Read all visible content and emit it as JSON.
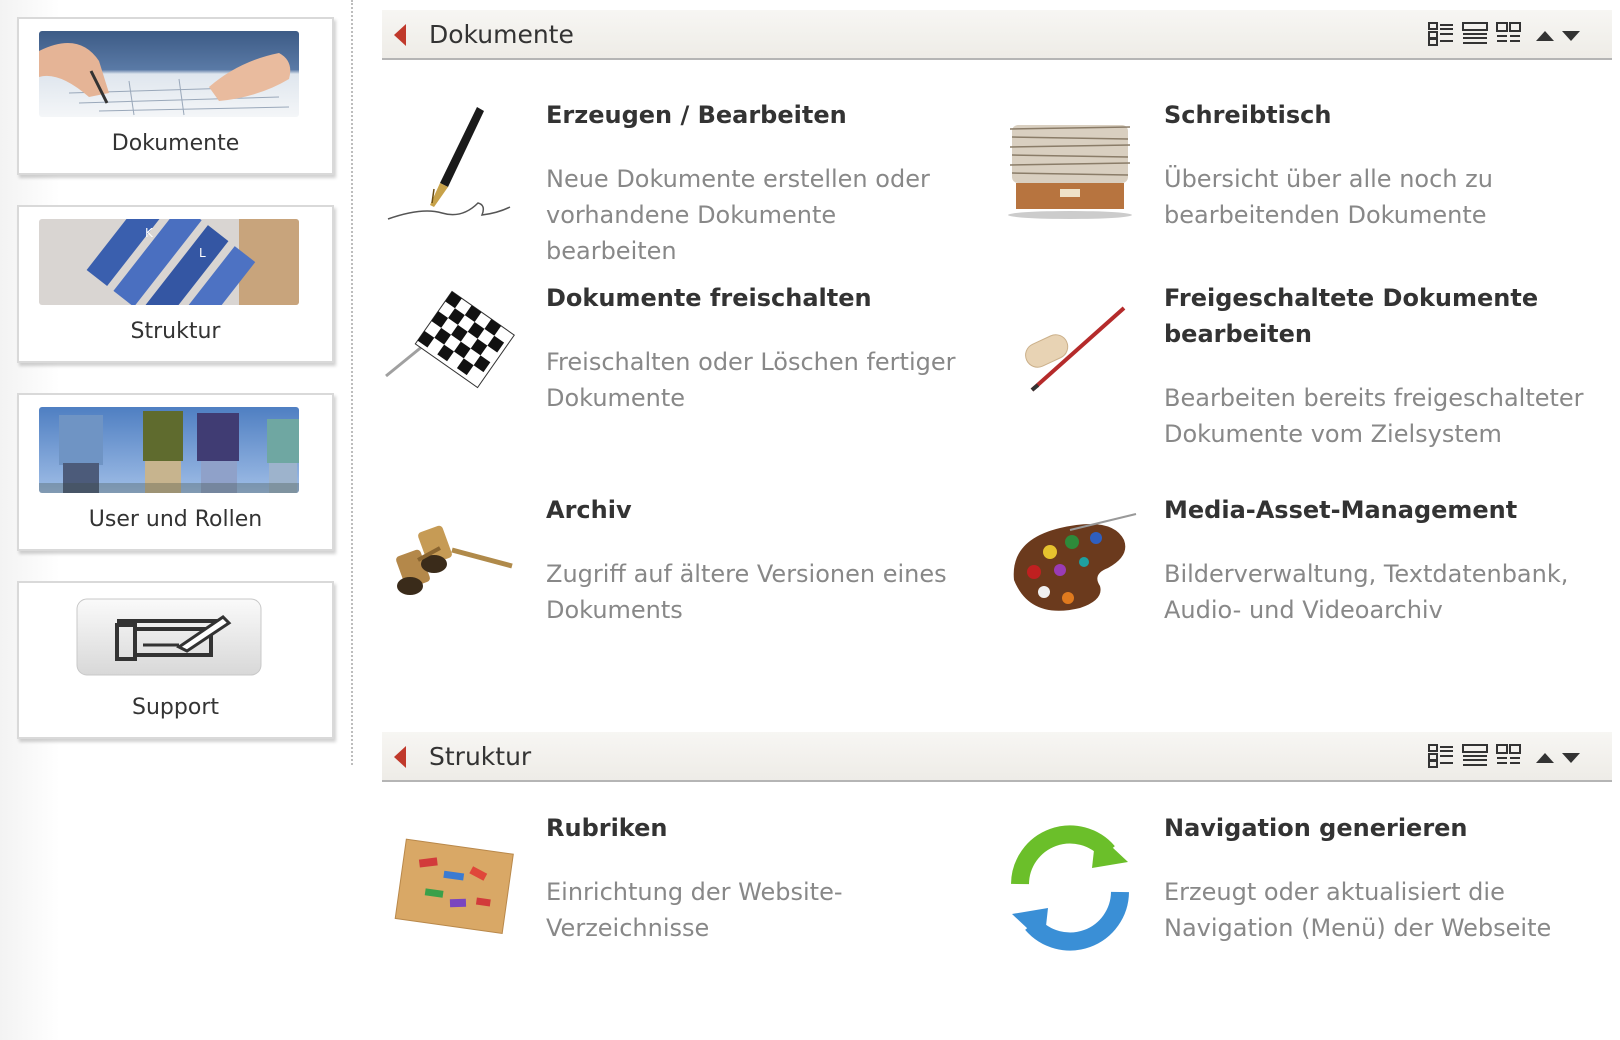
{
  "sidebar": {
    "tiles": [
      {
        "label": "Dokumente",
        "thumb": "document-writing-photo"
      },
      {
        "label": "Struktur",
        "thumb": "folder-tabs-photo"
      },
      {
        "label": "User und Rollen",
        "thumb": "people-group-photo"
      },
      {
        "label": "Support",
        "thumb": "printer-icon"
      }
    ]
  },
  "sections": [
    {
      "title": "Dokumente",
      "items": [
        {
          "title": "Erzeugen / Bearbeiten",
          "description": "Neue Dokumente erstellen oder vorhandene Dokumente bearbeiten",
          "icon": "fountain-pen-icon"
        },
        {
          "title": "Schreibtisch",
          "description": "Übersicht über alle noch zu bearbeitenden Dokumente",
          "icon": "paper-stack-icon"
        },
        {
          "title": "Dokumente freischalten",
          "description": "Freischalten oder Löschen fertiger Dokumente",
          "icon": "checkered-flag-icon"
        },
        {
          "title": "Freigeschaltete Dokumente bearbeiten",
          "description": "Bearbeiten bereits freigeschalteter Dokumente vom Zielsystem",
          "icon": "pencil-eraser-icon"
        },
        {
          "title": "Archiv",
          "description": "Zugriff auf ältere Versionen eines Dokuments",
          "icon": "opera-glasses-icon"
        },
        {
          "title": "Media-Asset-Management",
          "description": "Bilderverwaltung, Textdatenbank, Audio- und Videoarchiv",
          "icon": "paint-palette-icon"
        }
      ]
    },
    {
      "title": "Struktur",
      "items": [
        {
          "title": "Rubriken",
          "description": "Einrichtung der Website-Verzeichnisse",
          "icon": "corkboard-icon"
        },
        {
          "title": "Navigation generieren",
          "description": "Erzeugt oder aktualisiert die Navigation (Menü) der Webseite",
          "icon": "refresh-arrows-icon"
        }
      ]
    }
  ],
  "colors": {
    "accent": "#c0392b",
    "title": "#333333",
    "description": "#888888"
  }
}
